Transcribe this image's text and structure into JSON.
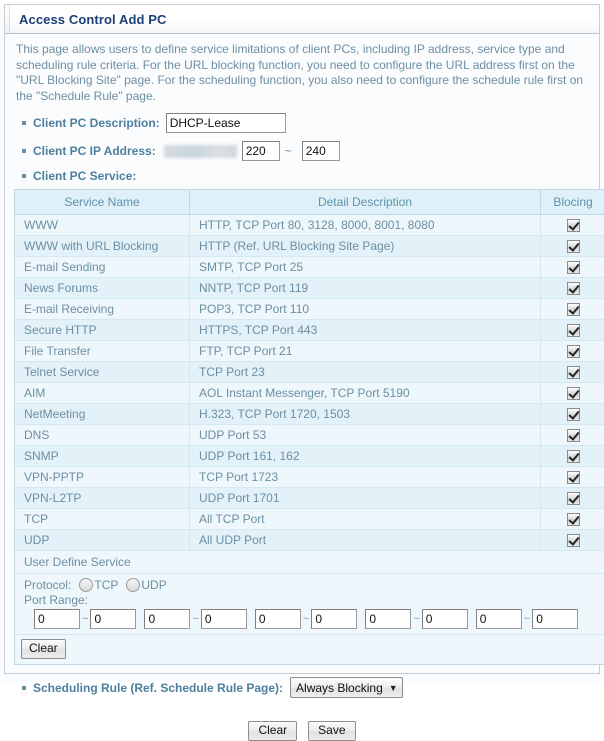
{
  "window": {
    "title": "Access Control Add PC"
  },
  "intro": "This page allows users to define service limitations of client PCs, including IP address, service type and scheduling rule criteria. For the URL blocking function, you need to configure the URL address first on the \"URL Blocking Site\" page. For the scheduling function, you also need to configure the schedule rule first on the \"Schedule Rule\" page.",
  "fields": {
    "description_label": "Client PC Description:",
    "description_value": "DHCP-Lease",
    "ip_label": "Client PC IP Address:",
    "ip_prefix": "",
    "ip_start": "220",
    "ip_end": "240",
    "ip_separator": "~",
    "service_label": "Client PC Service:"
  },
  "table": {
    "headers": [
      "Service Name",
      "Detail Description",
      "Blocing"
    ],
    "rows": [
      {
        "name": "WWW",
        "detail": "HTTP, TCP Port 80, 3128, 8000, 8001, 8080",
        "blocking": true
      },
      {
        "name": "WWW with URL Blocking",
        "detail": "HTTP (Ref. URL Blocking Site Page)",
        "blocking": true
      },
      {
        "name": "E-mail Sending",
        "detail": "SMTP, TCP Port 25",
        "blocking": true
      },
      {
        "name": "News Forums",
        "detail": "NNTP, TCP Port 119",
        "blocking": true
      },
      {
        "name": "E-mail Receiving",
        "detail": "POP3, TCP Port 110",
        "blocking": true
      },
      {
        "name": "Secure HTTP",
        "detail": "HTTPS, TCP Port 443",
        "blocking": true
      },
      {
        "name": "File Transfer",
        "detail": "FTP, TCP Port 21",
        "blocking": true
      },
      {
        "name": "Telnet Service",
        "detail": "TCP Port 23",
        "blocking": true
      },
      {
        "name": "AIM",
        "detail": "AOL Instant Messenger, TCP Port 5190",
        "blocking": true
      },
      {
        "name": "NetMeeting",
        "detail": "H.323, TCP Port 1720, 1503",
        "blocking": true
      },
      {
        "name": "DNS",
        "detail": "UDP Port 53",
        "blocking": true
      },
      {
        "name": "SNMP",
        "detail": "UDP Port 161, 162",
        "blocking": true
      },
      {
        "name": "VPN-PPTP",
        "detail": "TCP Port 1723",
        "blocking": true
      },
      {
        "name": "VPN-L2TP",
        "detail": "UDP Port 1701",
        "blocking": true
      },
      {
        "name": "TCP",
        "detail": "All TCP Port",
        "blocking": true
      },
      {
        "name": "UDP",
        "detail": "All UDP Port",
        "blocking": true
      }
    ]
  },
  "user_define": {
    "title": "User Define Service",
    "protocol_label": "Protocol:",
    "protocol_options": [
      "TCP",
      "UDP"
    ],
    "protocol_selected": "",
    "port_range_label": "Port Range:",
    "port_separator": "~",
    "port_pairs": [
      {
        "from": "0",
        "to": "0"
      },
      {
        "from": "0",
        "to": "0"
      },
      {
        "from": "0",
        "to": "0"
      },
      {
        "from": "0",
        "to": "0"
      },
      {
        "from": "0",
        "to": "0"
      }
    ],
    "clear_label": "Clear"
  },
  "scheduling": {
    "label": "Scheduling Rule (Ref. Schedule Rule Page):",
    "selected": "Always Blocking",
    "caret": "▼"
  },
  "footer": {
    "clear_label": "Clear",
    "save_label": "Save"
  },
  "colors": {
    "title_text": "#1b3f78",
    "label_text": "#4d7f9e",
    "body_text": "#6d8fa3",
    "table_header_bg": "#dff0f8",
    "row_odd_bg": "#eef7fb",
    "row_even_bg": "#e3f1f8"
  }
}
